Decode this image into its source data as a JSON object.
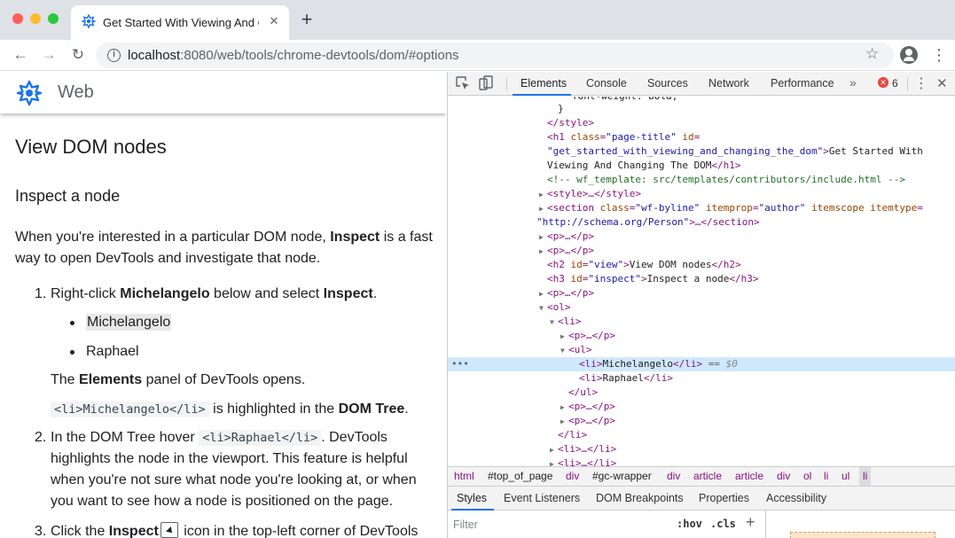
{
  "browser": {
    "tab_title": "Get Started With Viewing And Changing the DOM",
    "url_host": "localhost",
    "url_path": ":8080/web/tools/chrome-devtools/dom/#options",
    "new_tab_glyph": "+",
    "close_tab_glyph": "✕",
    "back_glyph": "←",
    "forward_glyph": "→",
    "reload_glyph": "↻",
    "star_glyph": "☆",
    "menu_glyph": "⋮"
  },
  "page": {
    "site_name": "Web",
    "h1": "View DOM nodes",
    "h3": "Inspect a node",
    "intro_before": "When you're interested in a particular DOM node, ",
    "intro_bold": "Inspect",
    "intro_after": " is a fast way to open DevTools and investigate that node.",
    "step1_num": "1.",
    "step1_a": "Right-click ",
    "step1_b": "Michelangelo",
    "step1_c": " below and select ",
    "step1_d": "Inspect",
    "step1_e": ".",
    "bullet1": "Michelangelo",
    "bullet2": "Raphael",
    "panel_a": "The ",
    "panel_b": "Elements",
    "panel_c": " panel of DevTools opens.",
    "code_li_michelangelo": "<li>Michelangelo</li>",
    "highlighted_a": " is highlighted in the ",
    "highlighted_b": "DOM Tree",
    "highlighted_c": ".",
    "step2_num": "2.",
    "step2_a": "In the DOM Tree hover ",
    "code_li_raphael": "<li>Raphael</li>",
    "step2_b": ". DevTools highlights the node in the viewport. This feature is helpful when you're not sure what node you're looking at, or when you want to see how a node is positioned on the page.",
    "step3_num": "3.",
    "step3_a": "Click the ",
    "step3_b": "Inspect",
    "step3_c": " icon in the top-left corner of DevTools"
  },
  "devtools": {
    "tabs": [
      "Elements",
      "Console",
      "Sources",
      "Network",
      "Performance"
    ],
    "more_glyph": "»",
    "error_count": "6",
    "close_glyph": "✕",
    "kebab_glyph": "⋮",
    "dom_lines": {
      "l0": "font-weight: bold;",
      "l1": "}",
      "l2_tag": "</style>",
      "l3_open": "<h1 ",
      "l3_attr1": "class",
      "l3_val1": "\"page-title\"",
      "l3_attr2": "id",
      "l4_val2": "\"get_started_with_viewing_and_changing_the_dom\"",
      "l4_text": "Get Started With",
      "l5_text": "Viewing And Changing The DOM",
      "l5_close": "</h1>",
      "l6_comment": "<!-- wf_template: src/templates/contributors/include.html -->",
      "l7": "<style>…</style>",
      "l8_open": "<section ",
      "l8_attr1": "class",
      "l8_val1": "\"wf-byline\"",
      "l8_attr2": "itemprop",
      "l8_val2": "\"author\"",
      "l8_attr3": "itemscope",
      "l8_attr4": "itemtype",
      "l9_val": "\"http://schema.org/Person\"",
      "l9_rest": ">…</section>",
      "l10": "<p>…</p>",
      "l11": "<p>…</p>",
      "l12_open": "<h2 ",
      "l12_attr": "id",
      "l12_val": "\"view\"",
      "l12_text": "View DOM nodes",
      "l12_close": "</h2>",
      "l13_open": "<h3 ",
      "l13_attr": "id",
      "l13_val": "\"inspect\"",
      "l13_text": "Inspect a node",
      "l13_close": "</h3>",
      "l14": "<p>…</p>",
      "l15": "<ol>",
      "l16": "<li>",
      "l17": "<p>…</p>",
      "l18": "<ul>",
      "l19_open": "<li>",
      "l19_text": "Michelangelo",
      "l19_close": "</li>",
      "l19_eq": " == ",
      "l19_ref": "$0",
      "l20_open": "<li>",
      "l20_text": "Raphael",
      "l20_close": "</li>",
      "l21": "</ul>",
      "l22": "<p>…</p>",
      "l23": "<p>…</p>",
      "l24": "</li>",
      "l25": "<li>…</li>",
      "l26": "<li>…</li>"
    },
    "breadcrumbs": [
      "html",
      "#top_of_page",
      "div",
      "#gc-wrapper",
      "div",
      "article",
      "article",
      "div",
      "ol",
      "li",
      "ul",
      "li"
    ],
    "subtabs": [
      "Styles",
      "Event Listeners",
      "DOM Breakpoints",
      "Properties",
      "Accessibility"
    ],
    "filter_placeholder": "Filter",
    "hov": ":hov",
    "cls": ".cls",
    "plus": "+"
  }
}
